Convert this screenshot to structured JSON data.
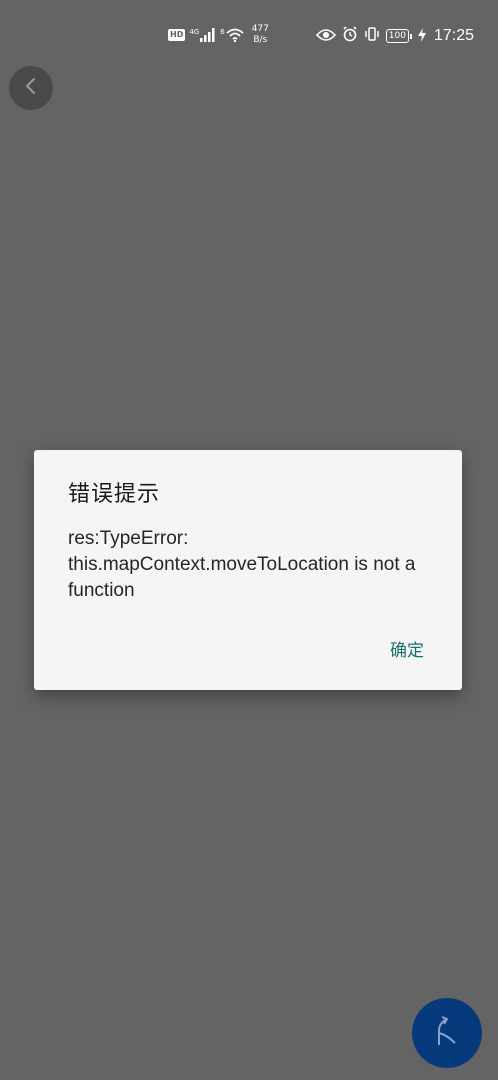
{
  "status_bar": {
    "hd_label": "HD",
    "network_label": "4G",
    "wifi_label": "6",
    "speed_value": "477",
    "speed_unit": "B/s",
    "battery_level": "100",
    "time": "17:25"
  },
  "dialog": {
    "title": "错误提示",
    "message": "res:TypeError: this.mapContext.moveToLocation is not a function",
    "confirm_label": "确定"
  },
  "colors": {
    "overlay": "#646464",
    "dialog_bg": "#f5f5f5",
    "confirm_text": "#1a6f6a",
    "fab_bg": "#073a7c"
  },
  "icons": {
    "back": "chevron-left-icon",
    "fab": "navigation-arrow-icon"
  }
}
